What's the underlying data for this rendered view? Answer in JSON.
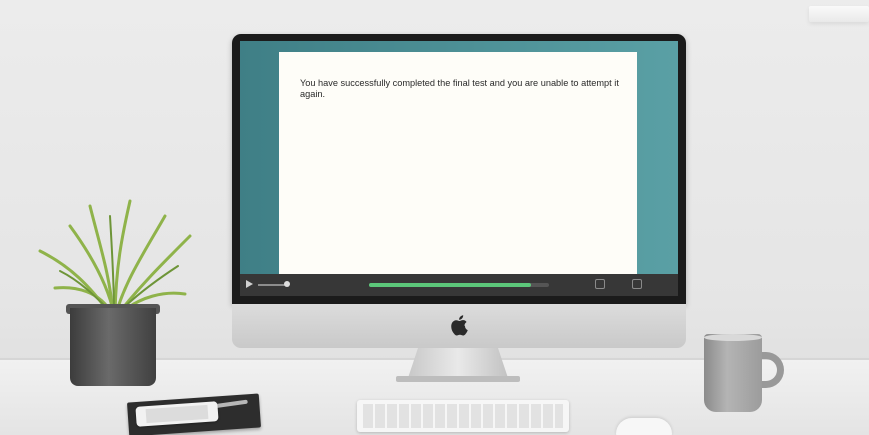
{
  "slide": {
    "message": "You have successfully completed the final test and you are unable to attempt it again."
  },
  "player": {
    "progress": 0.9,
    "colors": {
      "progress_fill": "#5cc77a",
      "bar": "#373737",
      "side_panel": "#4f9499"
    }
  },
  "icons": {
    "play": "play-icon",
    "volume": "volume-icon",
    "settings": "settings-icon",
    "fullscreen": "fullscreen-icon",
    "brand": "apple-logo-icon"
  }
}
